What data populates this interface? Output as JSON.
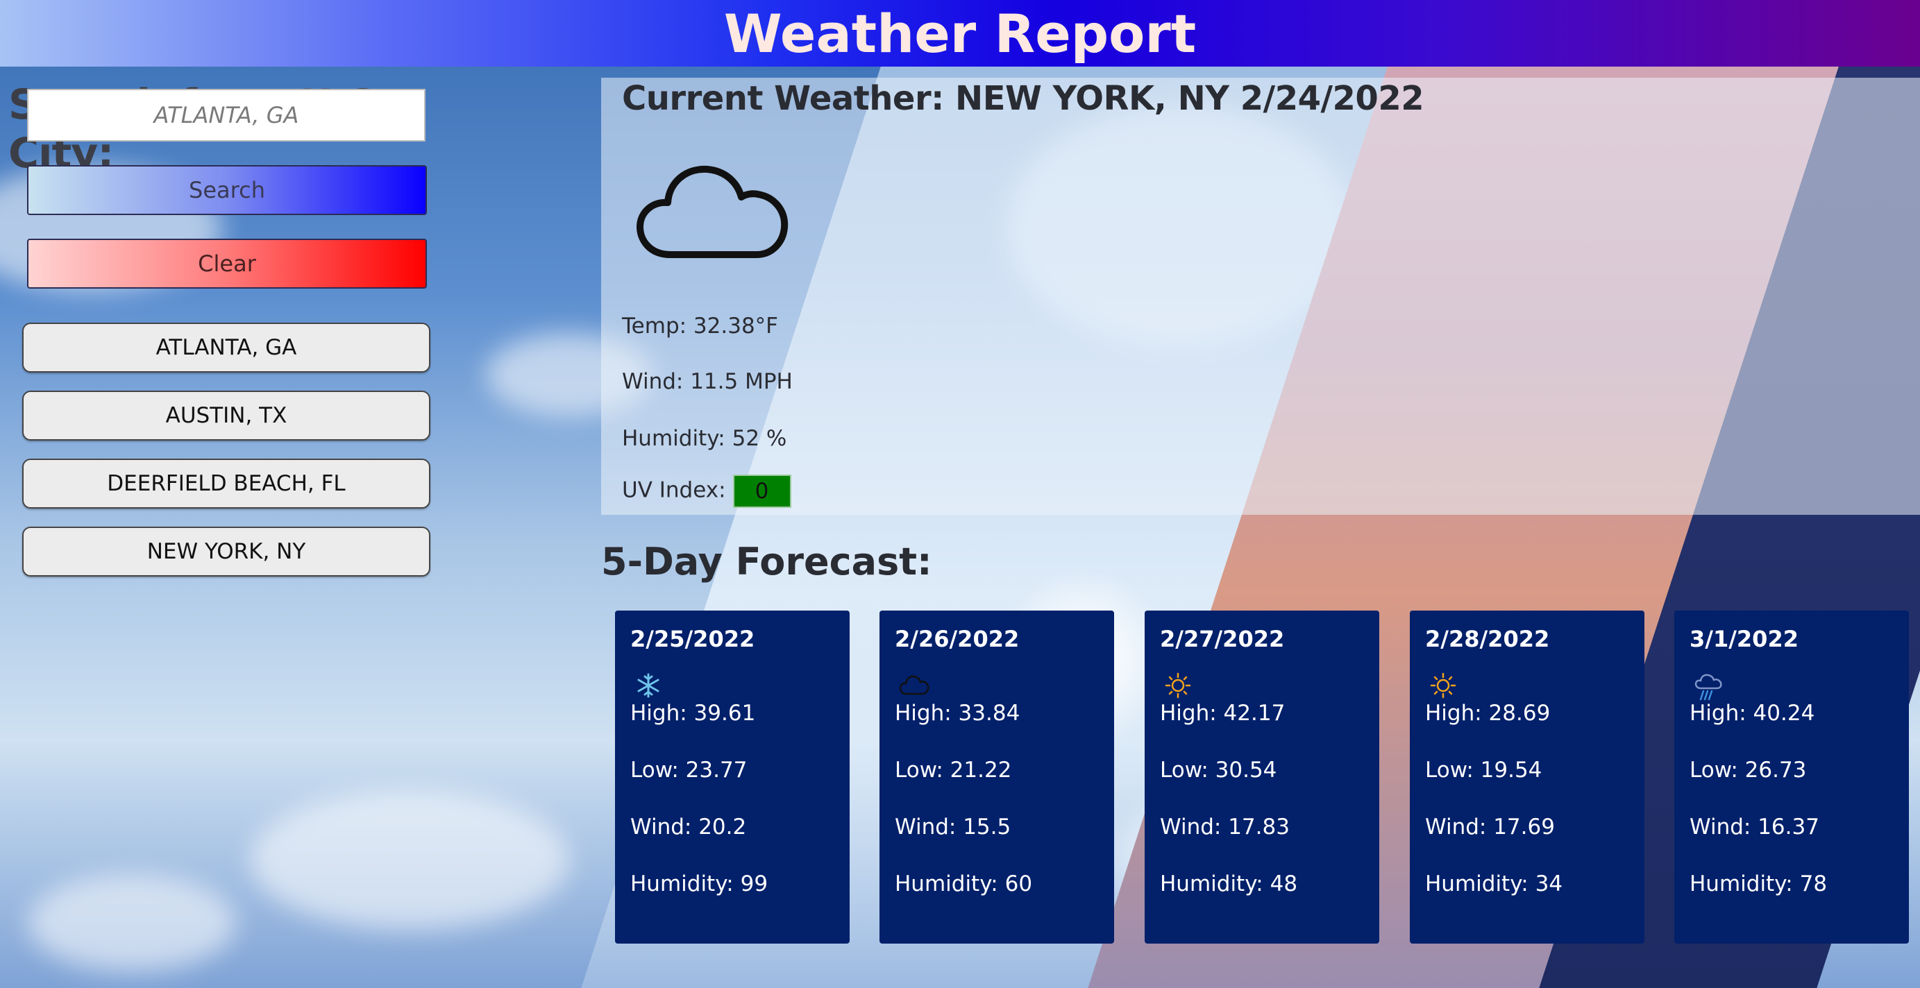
{
  "header": {
    "title": "Weather Report"
  },
  "sidebar": {
    "heading": "Search for a U.S. City:",
    "search_placeholder": "ATLANTA, GA",
    "search_label": "Search",
    "clear_label": "Clear",
    "history": [
      "ATLANTA, GA",
      "AUSTIN, TX",
      "DEERFIELD BEACH, FL",
      "NEW YORK, NY"
    ]
  },
  "current": {
    "title": "Current Weather: NEW YORK, NY 2/24/2022",
    "icon": "cloud-icon",
    "temp": "Temp: 32.38°F",
    "wind": "Wind: 11.5 MPH",
    "humidity": "Humidity: 52 %",
    "uv_label": "UV Index:",
    "uv_value": "0",
    "uv_color": "#008000"
  },
  "forecast": {
    "title": "5-Day Forecast:",
    "days": [
      {
        "date": "2/25/2022",
        "icon": "snowflake-icon",
        "high": "High: 39.61",
        "low": "Low: 23.77",
        "wind": "Wind: 20.2",
        "humidity": "Humidity: 99"
      },
      {
        "date": "2/26/2022",
        "icon": "cloud-icon",
        "high": "High: 33.84",
        "low": "Low: 21.22",
        "wind": "Wind: 15.5",
        "humidity": "Humidity: 60"
      },
      {
        "date": "2/27/2022",
        "icon": "sun-icon",
        "high": "High: 42.17",
        "low": "Low: 30.54",
        "wind": "Wind: 17.83",
        "humidity": "Humidity: 48"
      },
      {
        "date": "2/28/2022",
        "icon": "sun-icon",
        "high": "High: 28.69",
        "low": "Low: 19.54",
        "wind": "Wind: 17.69",
        "humidity": "Humidity: 34"
      },
      {
        "date": "3/1/2022",
        "icon": "rain-icon",
        "high": "High: 40.24",
        "low": "Low: 26.73",
        "wind": "Wind: 16.37",
        "humidity": "Humidity: 78"
      }
    ],
    "card_color": "#03206a"
  },
  "colors": {
    "header_start": "#a7c3f5",
    "header_mid": "#1500e0",
    "header_end": "#6a008f",
    "title_text": "#fde8e2"
  }
}
